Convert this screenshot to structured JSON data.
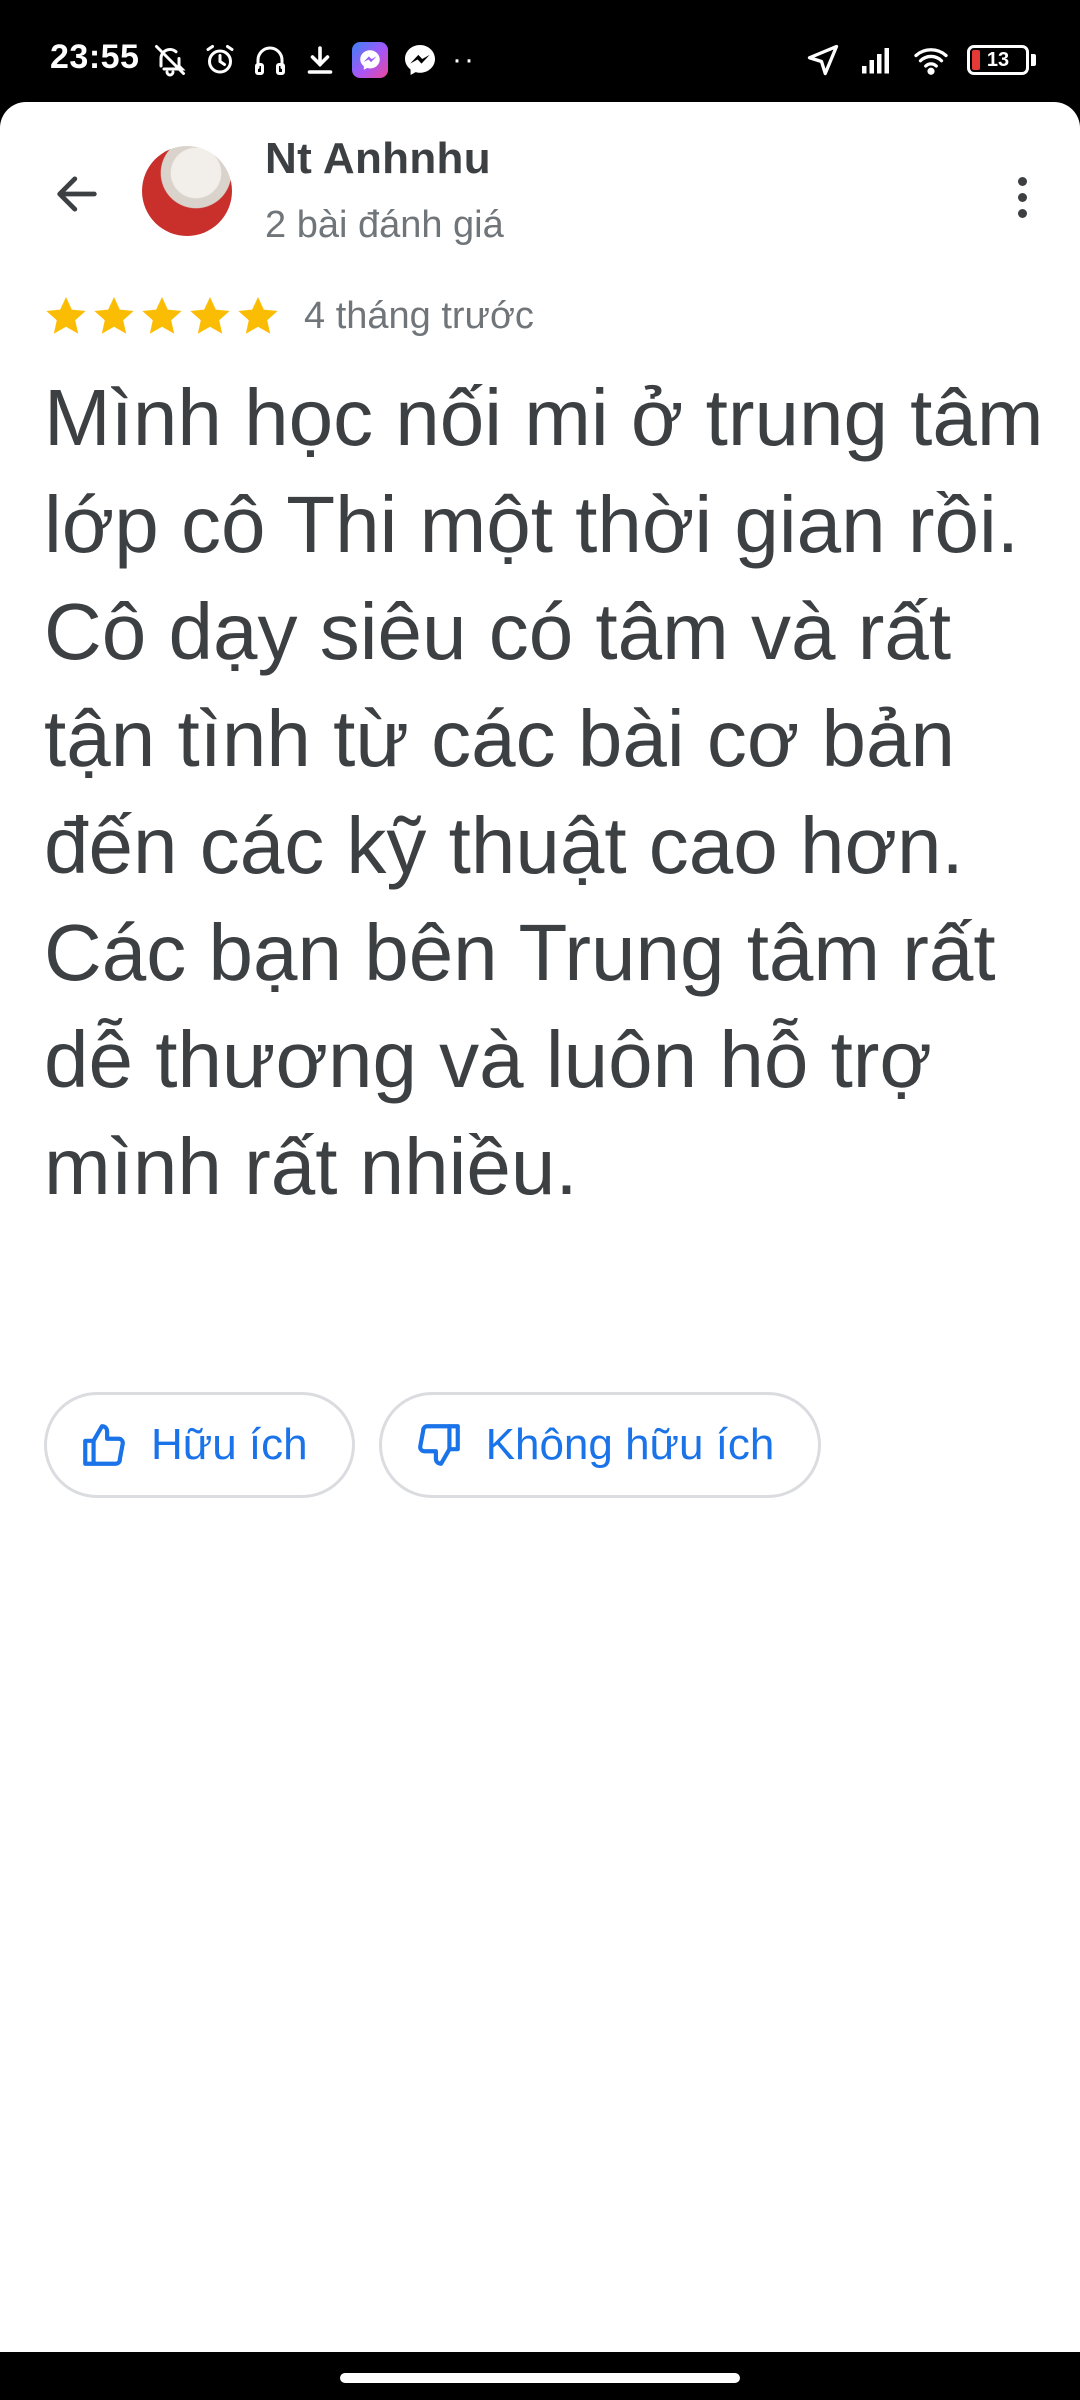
{
  "status_bar": {
    "time": "23:55",
    "left_icons": [
      "mute-icon",
      "alarm-icon",
      "headphones-icon",
      "download-icon",
      "messenger-icon",
      "messenger-outline-icon",
      "more-notifications-icon"
    ],
    "right_icons": [
      "location-icon",
      "signal-icon",
      "wifi-icon",
      "battery-icon"
    ],
    "more_dots": "··",
    "battery_level": "13",
    "battery_color": "#e53935"
  },
  "header": {
    "back_icon": "arrow-left-icon",
    "reviewer_name": "Nt Anhnhu",
    "review_count": "2 bài đánh giá",
    "menu_icon": "more-vert-icon"
  },
  "review": {
    "stars": 5,
    "star_color": "#fbbc04",
    "date": "4 tháng trước",
    "text": "Mình học nối mi ở trung tâm lớp cô Thi một thời gian rồi. Cô dạy siêu có tâm và rất tận tình từ các bài cơ bản đến các kỹ thuật cao hơn. Các bạn bên Trung tâm rất dễ thương và luôn hỗ trợ mình rất nhiều."
  },
  "actions": {
    "helpful_label": "Hữu ích",
    "not_helpful_label": "Không hữu ích",
    "accent_color": "#1a73e8"
  }
}
